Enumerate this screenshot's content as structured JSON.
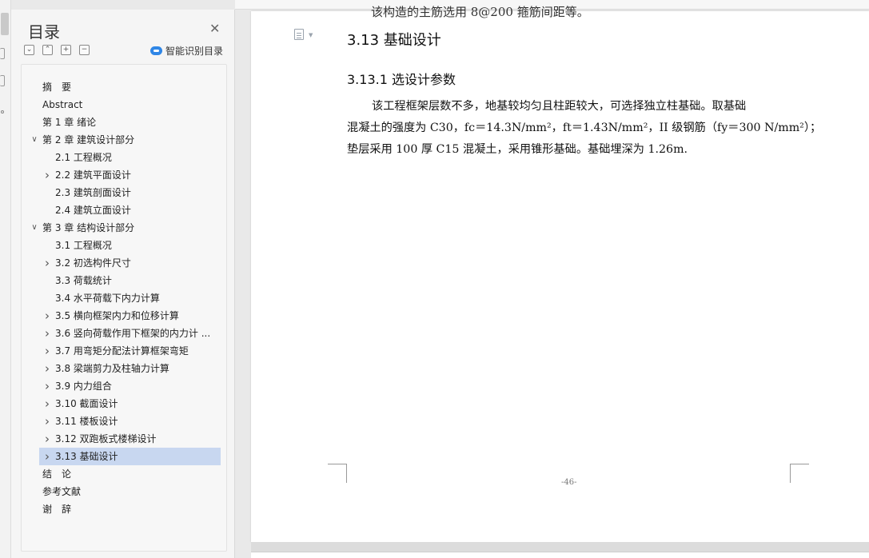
{
  "toc_panel": {
    "title": "目录",
    "close_icon": "close-icon",
    "tools": [
      "chevron-down-icon",
      "chevron-up-icon",
      "plus-icon",
      "minus-icon"
    ],
    "smart_label": "智能识别目录",
    "items": [
      {
        "label": "摘　要",
        "level": 0,
        "arrow": ""
      },
      {
        "label": "Abstract",
        "level": 0,
        "arrow": ""
      },
      {
        "label": "第 1 章  绪论",
        "level": 0,
        "arrow": ""
      },
      {
        "label": "第 2 章  建筑设计部分",
        "level": 0,
        "arrow": "expanded"
      },
      {
        "label": "2.1 工程概况",
        "level": 1,
        "arrow": ""
      },
      {
        "label": "2.2 建筑平面设计",
        "level": 1,
        "arrow": "collapsed"
      },
      {
        "label": "2.3 建筑剖面设计",
        "level": 1,
        "arrow": ""
      },
      {
        "label": "2.4 建筑立面设计",
        "level": 1,
        "arrow": ""
      },
      {
        "label": "第 3 章  结构设计部分",
        "level": 0,
        "arrow": "expanded"
      },
      {
        "label": "3.1 工程概况",
        "level": 1,
        "arrow": ""
      },
      {
        "label": "3.2  初选构件尺寸",
        "level": 1,
        "arrow": "collapsed"
      },
      {
        "label": "3.3 荷载统计",
        "level": 1,
        "arrow": ""
      },
      {
        "label": "3.4  水平荷载下内力计算",
        "level": 1,
        "arrow": ""
      },
      {
        "label": "3.5 横向框架内力和位移计算",
        "level": 1,
        "arrow": "collapsed"
      },
      {
        "label": "3.6 竖向荷载作用下框架的内力计 ...",
        "level": 1,
        "arrow": "collapsed"
      },
      {
        "label": "3.7 用弯矩分配法计算框架弯矩",
        "level": 1,
        "arrow": "collapsed"
      },
      {
        "label": "3.8  梁端剪力及柱轴力计算",
        "level": 1,
        "arrow": "collapsed"
      },
      {
        "label": "3.9  内力组合",
        "level": 1,
        "arrow": "collapsed"
      },
      {
        "label": "3.10 截面设计",
        "level": 1,
        "arrow": "collapsed"
      },
      {
        "label": "3.11 楼板设计",
        "level": 1,
        "arrow": "collapsed"
      },
      {
        "label": "3.12 双跑板式楼梯设计",
        "level": 1,
        "arrow": "collapsed"
      },
      {
        "label": "3.13 基础设计",
        "level": 1,
        "arrow": "collapsed",
        "selected": true
      },
      {
        "label": "结　论",
        "level": 0,
        "arrow": ""
      },
      {
        "label": "参考文献",
        "level": 0,
        "arrow": ""
      },
      {
        "label": "谢　辞",
        "level": 0,
        "arrow": ""
      }
    ]
  },
  "document": {
    "cut_text": "该构造的主筋选用 8@200 箍筋间距等。",
    "heading_section": "3.13 基础设计",
    "heading_subsection": "3.13.1 选设计参数",
    "para_line1": "该工程框架层数不多，地基较均匀且柱距较大，可选择独立柱基础。取基础",
    "para_line2": "混凝土的强度为 C30，fc＝14.3N/mm²，ft＝1.43N/mm²，II 级钢筋（fy＝300 N/mm²）；",
    "para_line3": "垫层采用 100  厚 C15 混凝土，采用锥形基础。基础埋深为 1.26m.",
    "page_number": "-46-"
  }
}
